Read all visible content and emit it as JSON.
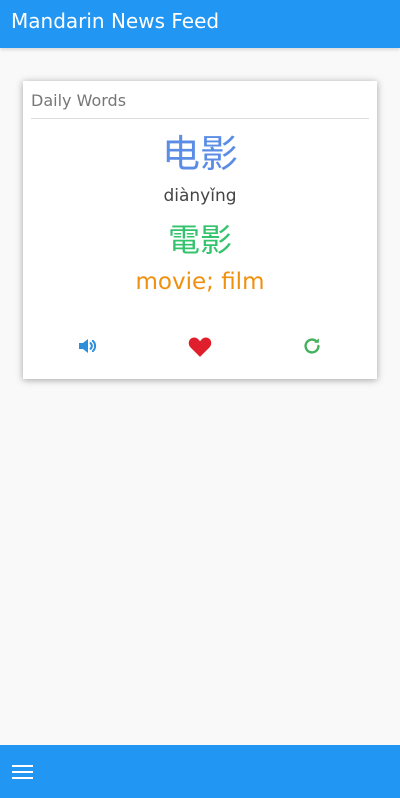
{
  "app": {
    "title": "Mandarin News Feed"
  },
  "card": {
    "header": "Daily Words",
    "simplified": "电影",
    "pinyin": "diànyǐng",
    "traditional": "電影",
    "meaning": "movie; film",
    "actions": [
      {
        "icon": "speaker-icon",
        "color": "#2d8fdc"
      },
      {
        "icon": "heart-icon",
        "color": "#e01f2c"
      },
      {
        "icon": "refresh-icon",
        "color": "#45b15c"
      }
    ]
  },
  "bottom_bar": {
    "icon": "hamburger-menu-icon"
  },
  "colors": {
    "primary": "#2196f3",
    "simplified": "#5b8de6",
    "traditional": "#34c36d",
    "meaning": "#f0900f"
  }
}
